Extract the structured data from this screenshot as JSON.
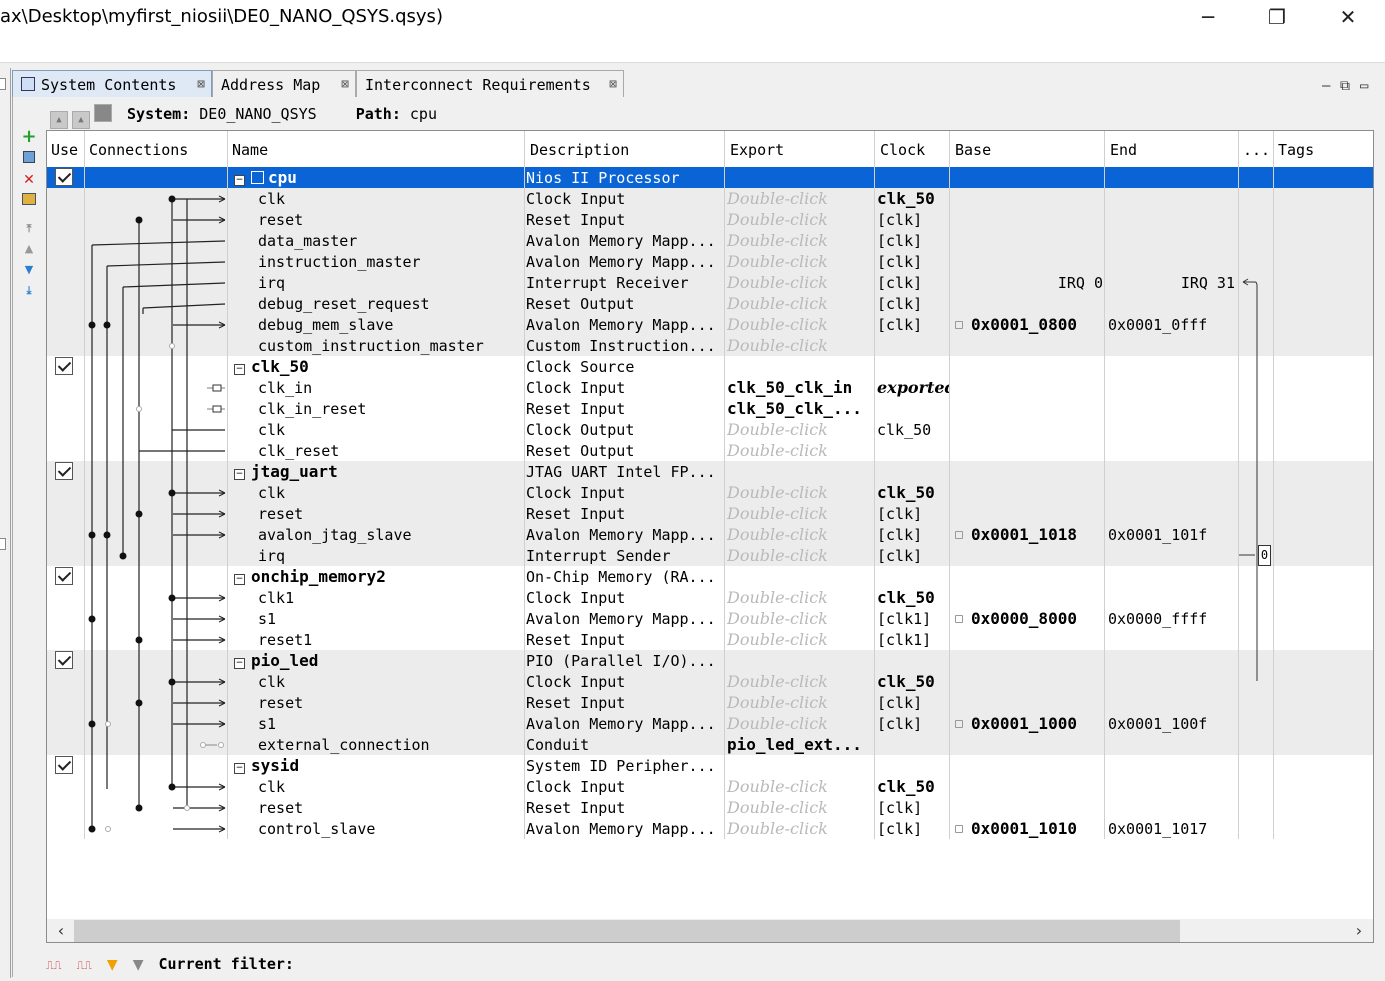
{
  "window": {
    "title": "ax\\Desktop\\myfirst_niosii\\DE0_NANO_QSYS.qsys)",
    "minimize": "─",
    "restore": "❐",
    "close": "✕"
  },
  "tabs": [
    {
      "label": "System Contents",
      "active": true
    },
    {
      "label": "Address Map",
      "active": false
    },
    {
      "label": "Interconnect Requirements",
      "active": false
    }
  ],
  "tab_close": "⊠",
  "view_buttons": [
    "–",
    "⧉",
    "▭"
  ],
  "sysbar": {
    "system_label": "System:",
    "system_value": "DE0_NANO_QSYS",
    "path_label": "Path:",
    "path_value": "cpu"
  },
  "columns": [
    "Use",
    "Connections",
    "Name",
    "Description",
    "Export",
    "Clock",
    "Base",
    "End",
    "...",
    "Tags"
  ],
  "rows": [
    {
      "type": "comp",
      "name": "cpu",
      "desc": "Nios II Processor",
      "export": "",
      "clock": "",
      "base": "",
      "end": "",
      "selected": true
    },
    {
      "type": "port",
      "name": "clk",
      "desc": "Clock Input",
      "export": "Double-click",
      "clock": "clk_50",
      "clock_bold": true
    },
    {
      "type": "port",
      "name": "reset",
      "desc": "Reset Input",
      "export": "Double-click",
      "clock": "[clk]"
    },
    {
      "type": "port",
      "name": "data_master",
      "desc": "Avalon Memory Mapp...",
      "export": "Double-click",
      "clock": "[clk]"
    },
    {
      "type": "port",
      "name": "instruction_master",
      "desc": "Avalon Memory Mapp...",
      "export": "Double-click",
      "clock": "[clk]"
    },
    {
      "type": "port",
      "name": "irq",
      "desc": "Interrupt Receiver",
      "export": "Double-click",
      "clock": "[clk]",
      "base": "IRQ 0",
      "end": "IRQ 31",
      "irq": true
    },
    {
      "type": "port",
      "name": "debug_reset_request",
      "desc": "Reset Output",
      "export": "Double-click",
      "clock": "[clk]"
    },
    {
      "type": "port",
      "name": "debug_mem_slave",
      "desc": "Avalon Memory Mapp...",
      "export": "Double-click",
      "clock": "[clk]",
      "base": "0x0001_0800",
      "end": "0x0001_0fff"
    },
    {
      "type": "port",
      "name": "custom_instruction_master",
      "desc": "Custom Instruction...",
      "export": "Double-click",
      "clock": ""
    },
    {
      "type": "comp",
      "name": "clk_50",
      "desc": "Clock Source",
      "export": "",
      "clock": ""
    },
    {
      "type": "port",
      "name": "clk_in",
      "desc": "Clock Input",
      "export": "clk_50_clk_in",
      "export_bold": true,
      "clock": "exported",
      "clock_italic": true
    },
    {
      "type": "port",
      "name": "clk_in_reset",
      "desc": "Reset Input",
      "export": "clk_50_clk_...",
      "export_bold": true,
      "clock": ""
    },
    {
      "type": "port",
      "name": "clk",
      "desc": "Clock Output",
      "export": "Double-click",
      "clock": "clk_50"
    },
    {
      "type": "port",
      "name": "clk_reset",
      "desc": "Reset Output",
      "export": "Double-click",
      "clock": ""
    },
    {
      "type": "comp",
      "name": "jtag_uart",
      "desc": "JTAG UART Intel FP...",
      "export": "",
      "clock": ""
    },
    {
      "type": "port",
      "name": "clk",
      "desc": "Clock Input",
      "export": "Double-click",
      "clock": "clk_50",
      "clock_bold": true
    },
    {
      "type": "port",
      "name": "reset",
      "desc": "Reset Input",
      "export": "Double-click",
      "clock": "[clk]"
    },
    {
      "type": "port",
      "name": "avalon_jtag_slave",
      "desc": "Avalon Memory Mapp...",
      "export": "Double-click",
      "clock": "[clk]",
      "base": "0x0001_1018",
      "end": "0x0001_101f"
    },
    {
      "type": "port",
      "name": "irq",
      "desc": "Interrupt Sender",
      "export": "Double-click",
      "clock": "[clk]",
      "irq_value": "0"
    },
    {
      "type": "comp",
      "name": "onchip_memory2",
      "desc": "On-Chip Memory (RA...",
      "export": "",
      "clock": ""
    },
    {
      "type": "port",
      "name": "clk1",
      "desc": "Clock Input",
      "export": "Double-click",
      "clock": "clk_50",
      "clock_bold": true
    },
    {
      "type": "port",
      "name": "s1",
      "desc": "Avalon Memory Mapp...",
      "export": "Double-click",
      "clock": "[clk1]",
      "base": "0x0000_8000",
      "end": "0x0000_ffff"
    },
    {
      "type": "port",
      "name": "reset1",
      "desc": "Reset Input",
      "export": "Double-click",
      "clock": "[clk1]"
    },
    {
      "type": "comp",
      "name": "pio_led",
      "desc": "PIO (Parallel I/O)...",
      "export": "",
      "clock": ""
    },
    {
      "type": "port",
      "name": "clk",
      "desc": "Clock Input",
      "export": "Double-click",
      "clock": "clk_50",
      "clock_bold": true
    },
    {
      "type": "port",
      "name": "reset",
      "desc": "Reset Input",
      "export": "Double-click",
      "clock": "[clk]"
    },
    {
      "type": "port",
      "name": "s1",
      "desc": "Avalon Memory Mapp...",
      "export": "Double-click",
      "clock": "[clk]",
      "base": "0x0001_1000",
      "end": "0x0001_100f"
    },
    {
      "type": "port",
      "name": "external_connection",
      "desc": "Conduit",
      "export": "pio_led_ext...",
      "export_bold": true,
      "clock": ""
    },
    {
      "type": "comp",
      "name": "sysid",
      "desc": "System ID Peripher...",
      "export": "",
      "clock": ""
    },
    {
      "type": "port",
      "name": "clk",
      "desc": "Clock Input",
      "export": "Double-click",
      "clock": "clk_50",
      "clock_bold": true
    },
    {
      "type": "port",
      "name": "reset",
      "desc": "Reset Input",
      "export": "Double-click",
      "clock": "[clk]"
    },
    {
      "type": "port",
      "name": "control_slave",
      "desc": "Avalon Memory Mapp...",
      "export": "Double-click",
      "clock": "[clk]",
      "base": "0x0001_1010",
      "end": "0x0001_1017"
    }
  ],
  "filter": {
    "label": "Current filter:"
  },
  "colors": {
    "selection": "#0a64d6",
    "odd_row": "#ececec",
    "placeholder": "#b9b9b9",
    "add_icon": "#22a030",
    "remove_icon": "#d02020",
    "move_icon": "#2a7fd4"
  },
  "icons": {
    "add": "plus-icon",
    "remove": "x-icon",
    "move_top": "move-top-icon",
    "move_up": "move-up-icon",
    "move_down": "move-down-icon",
    "move_bottom": "move-bottom-icon",
    "filter": "filter-icon"
  }
}
